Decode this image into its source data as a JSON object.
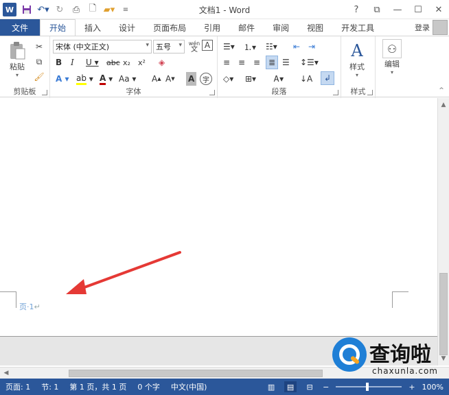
{
  "titlebar": {
    "app_badge": "W",
    "title": "文档1 - Word",
    "help": "?",
    "ribbon_display": "⧉",
    "minimize": "—",
    "restore": "☐",
    "close": "✕"
  },
  "tabs": {
    "file": "文件",
    "home": "开始",
    "insert": "插入",
    "design": "设计",
    "layout": "页面布局",
    "references": "引用",
    "mailings": "邮件",
    "review": "审阅",
    "view": "视图",
    "developer": "开发工具",
    "login": "登录"
  },
  "ribbon": {
    "clipboard": {
      "label": "剪贴板",
      "paste": "粘贴"
    },
    "font": {
      "label": "字体",
      "font_name": "宋体 (中文正文)",
      "font_size": "五号",
      "phonetic_top": "wén",
      "phonetic_bottom": "文"
    },
    "paragraph": {
      "label": "段落"
    },
    "styles": {
      "label": "样式",
      "button": "样式"
    },
    "editing": {
      "button": "编辑"
    }
  },
  "document": {
    "footer_text": "页·1",
    "pilcrow": "↵"
  },
  "status": {
    "page": "页面: 1",
    "section": "节: 1",
    "page_of": "第 1 页，共 1 页",
    "words": "0 个字",
    "language": "中文(中国)",
    "zoom": "100%"
  },
  "watermark": {
    "text": "查询啦",
    "domain": "chaxunla.com"
  },
  "colors": {
    "accent": "#2b579a",
    "arrow": "#e53935",
    "highlight": "#ffff00",
    "font_color": "#c00000"
  }
}
